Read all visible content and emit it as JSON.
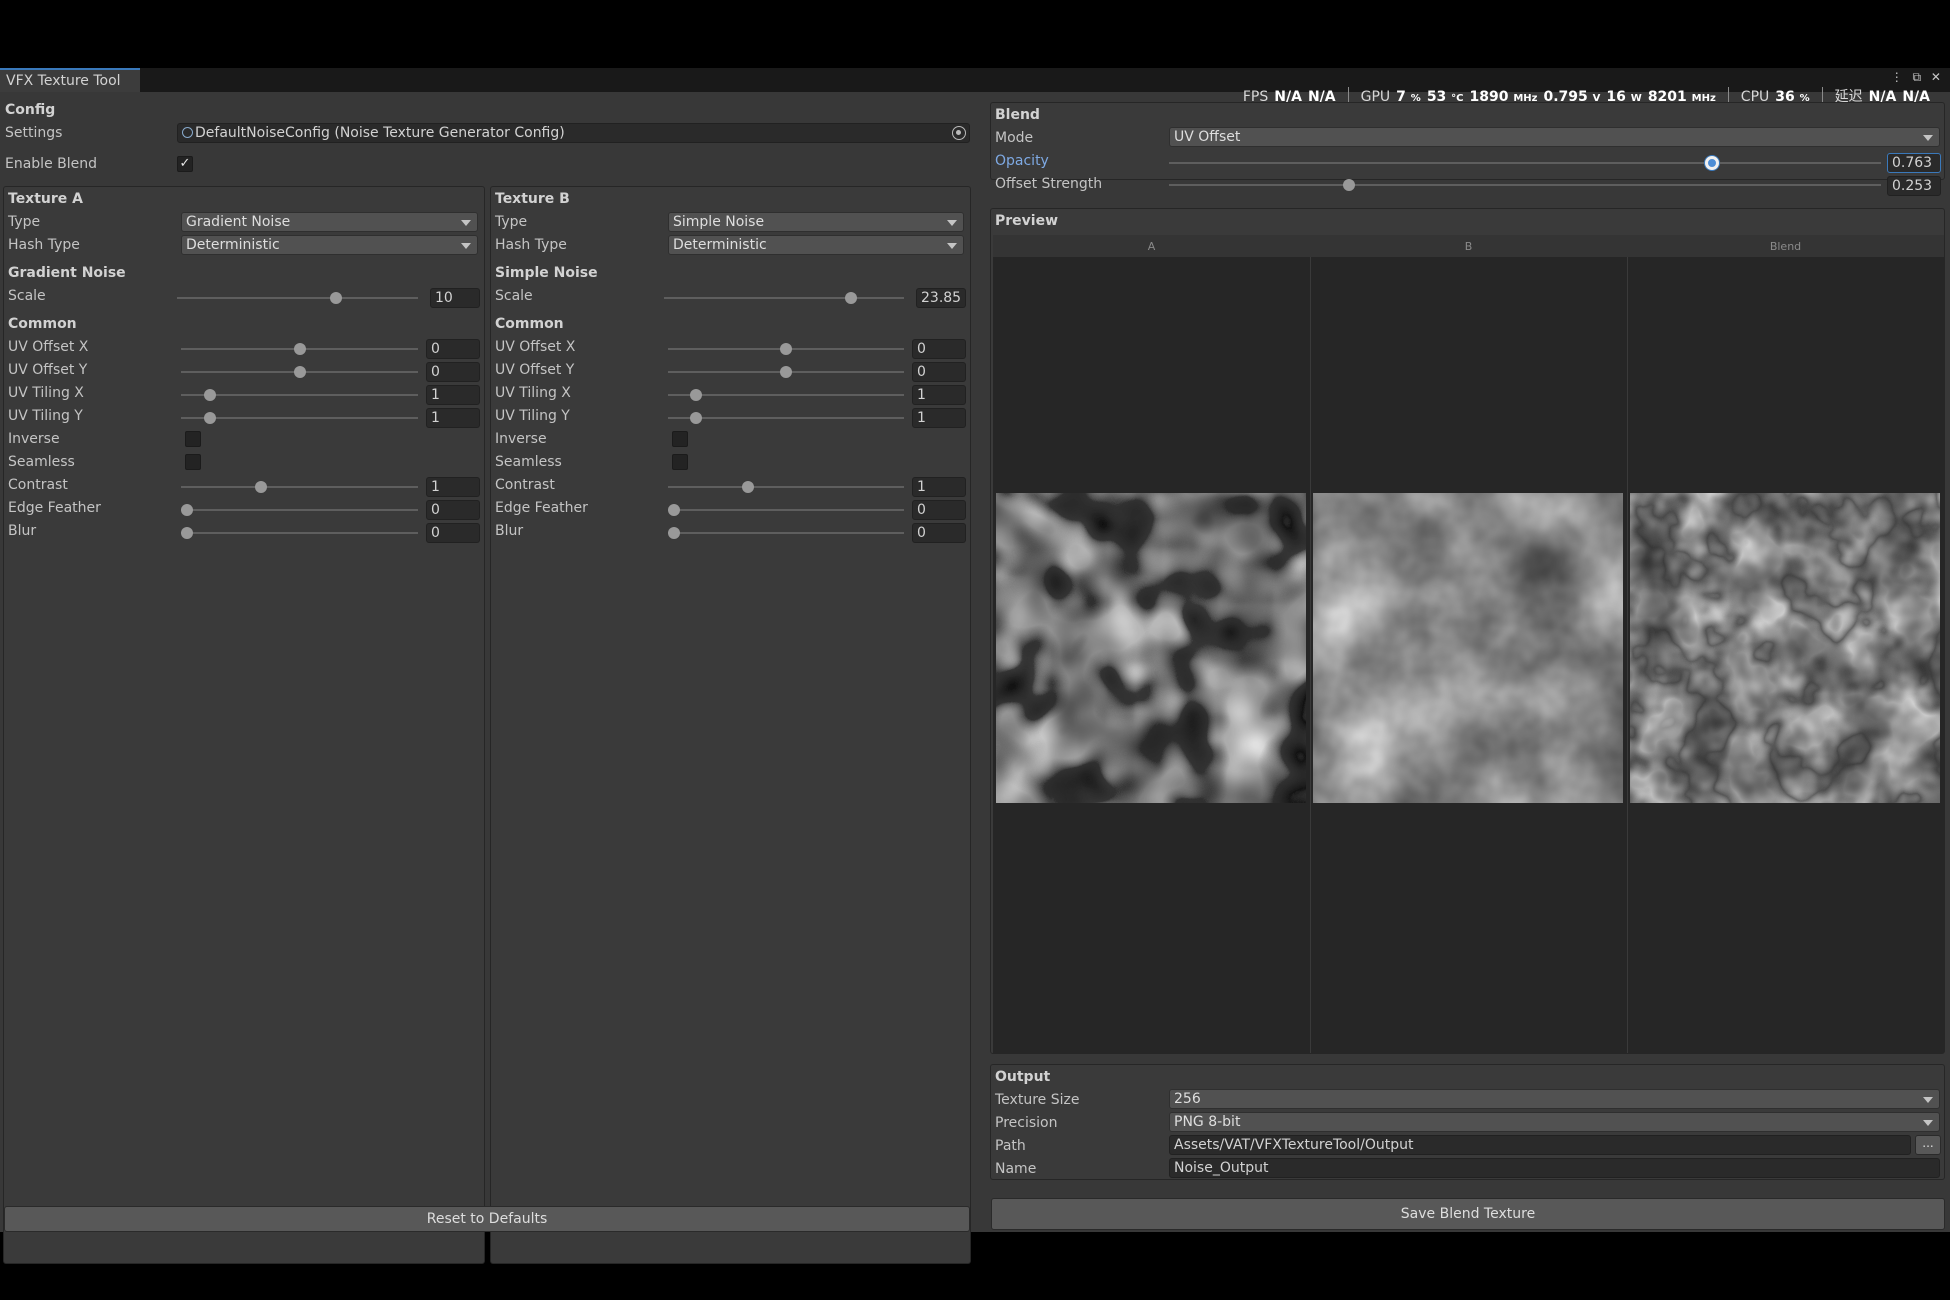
{
  "window": {
    "tab_title": "VFX Texture Tool",
    "window_buttons": "⋮ ⧉ ✕"
  },
  "hud": {
    "fps_label": "FPS",
    "fps_value": "N/A",
    "fps_value2": "N/A",
    "gpu_label": "GPU",
    "gpu_load": "7",
    "gpu_load_unit": "%",
    "gpu_temp": "53",
    "gpu_temp_unit": "°C",
    "gpu_clock": "1890",
    "gpu_clock_unit": "MHz",
    "gpu_voltage": "0.795",
    "gpu_voltage_unit": "V",
    "gpu_power": "16",
    "gpu_power_unit": "W",
    "gpu_mem_clock": "8201",
    "gpu_mem_clock_unit": "MHz",
    "cpu_label": "CPU",
    "cpu_load": "36",
    "cpu_load_unit": "%",
    "latency_label": "延迟",
    "latency_value": "N/A",
    "latency_value2": "N/A"
  },
  "config": {
    "header": "Config",
    "settings_label": "Settings",
    "settings_value": "DefaultNoiseConfig (Noise Texture Generator Config)",
    "enable_blend_label": "Enable Blend",
    "enable_blend_checked": "✓"
  },
  "texture_a": {
    "header": "Texture A",
    "type_label": "Type",
    "type_value": "Gradient Noise",
    "hash_label": "Hash Type",
    "hash_value": "Deterministic",
    "noise_header": "Gradient Noise",
    "scale_label": "Scale",
    "scale_value": "10",
    "scale_fraction": 0.66,
    "common_header": "Common",
    "rows": [
      {
        "label": "UV Offset X",
        "value": "0",
        "fraction": 0.5,
        "type": "slider"
      },
      {
        "label": "UV Offset Y",
        "value": "0",
        "fraction": 0.5,
        "type": "slider"
      },
      {
        "label": "UV Tiling X",
        "value": "1",
        "fraction": 0.1,
        "type": "slider"
      },
      {
        "label": "UV Tiling Y",
        "value": "1",
        "fraction": 0.1,
        "type": "slider"
      },
      {
        "label": "Inverse",
        "value": "",
        "type": "toggle"
      },
      {
        "label": "Seamless",
        "value": "",
        "type": "toggle"
      },
      {
        "label": "Contrast",
        "value": "1",
        "fraction": 0.33,
        "type": "slider"
      },
      {
        "label": "Edge Feather",
        "value": "0",
        "fraction": 0.0,
        "type": "slider"
      },
      {
        "label": "Blur",
        "value": "0",
        "fraction": 0.0,
        "type": "slider"
      }
    ]
  },
  "texture_b": {
    "header": "Texture B",
    "type_label": "Type",
    "type_value": "Simple Noise",
    "hash_label": "Hash Type",
    "hash_value": "Deterministic",
    "noise_header": "Simple Noise",
    "scale_label": "Scale",
    "scale_value": "23.85",
    "scale_fraction": 0.78,
    "common_header": "Common",
    "rows": [
      {
        "label": "UV Offset X",
        "value": "0",
        "fraction": 0.5,
        "type": "slider"
      },
      {
        "label": "UV Offset Y",
        "value": "0",
        "fraction": 0.5,
        "type": "slider"
      },
      {
        "label": "UV Tiling X",
        "value": "1",
        "fraction": 0.1,
        "type": "slider"
      },
      {
        "label": "UV Tiling Y",
        "value": "1",
        "fraction": 0.1,
        "type": "slider"
      },
      {
        "label": "Inverse",
        "value": "",
        "type": "toggle"
      },
      {
        "label": "Seamless",
        "value": "",
        "type": "toggle"
      },
      {
        "label": "Contrast",
        "value": "1",
        "fraction": 0.33,
        "type": "slider"
      },
      {
        "label": "Edge Feather",
        "value": "0",
        "fraction": 0.0,
        "type": "slider"
      },
      {
        "label": "Blur",
        "value": "0",
        "fraction": 0.0,
        "type": "slider"
      }
    ]
  },
  "reset_button": "Reset to Defaults",
  "blend": {
    "header": "Blend",
    "mode_label": "Mode",
    "mode_value": "UV Offset",
    "opacity_label": "Opacity",
    "opacity_value": "0.763",
    "opacity_fraction": 0.763,
    "offset_label": "Offset Strength",
    "offset_value": "0.253",
    "offset_fraction": 0.253
  },
  "preview": {
    "header": "Preview",
    "col_a": "A",
    "col_b": "B",
    "col_blend": "Blend"
  },
  "output": {
    "header": "Output",
    "size_label": "Texture Size",
    "size_value": "256",
    "precision_label": "Precision",
    "precision_value": "PNG 8-bit",
    "path_label": "Path",
    "path_value": "Assets/VAT/VFXTextureTool/Output",
    "browse_label": "...",
    "name_label": "Name",
    "name_value": "Noise_Output"
  },
  "save_button": "Save Blend Texture",
  "colors": {
    "accent": "#3a79bb",
    "panel": "#3a3a3a",
    "background": "#383838"
  }
}
